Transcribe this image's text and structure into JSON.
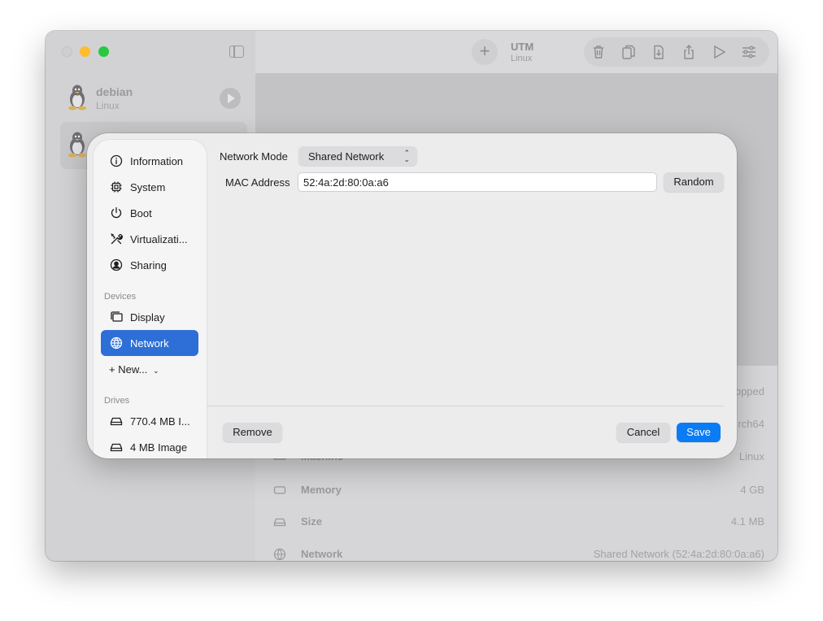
{
  "window": {
    "title": "UTM",
    "subtitle": "Linux",
    "toolbar_icons": [
      "trash-icon",
      "clone-icon",
      "download-icon",
      "share-icon",
      "play-icon",
      "sliders-icon"
    ]
  },
  "vm_list": [
    {
      "name": "debian",
      "os": "Linux"
    },
    {
      "name": "",
      "os": ""
    }
  ],
  "details": {
    "rows": [
      {
        "label": "",
        "value": "opped"
      },
      {
        "label": "",
        "value": "rch64"
      },
      {
        "label": "Machine",
        "value": "Linux"
      },
      {
        "label": "Memory",
        "value": "4 GB"
      },
      {
        "label": "Size",
        "value": "4.1 MB"
      },
      {
        "label": "Network",
        "value": "Shared Network (52:4a:2d:80:0a:a6)"
      }
    ]
  },
  "settings": {
    "nav": [
      {
        "label": "Information",
        "icon": "info-icon"
      },
      {
        "label": "System",
        "icon": "chip-icon"
      },
      {
        "label": "Boot",
        "icon": "power-icon"
      },
      {
        "label": "Virtualizati...",
        "icon": "tools-icon"
      },
      {
        "label": "Sharing",
        "icon": "person-icon"
      }
    ],
    "devices_header": "Devices",
    "devices": [
      {
        "label": "Display",
        "icon": "display-icon"
      },
      {
        "label": "Network",
        "icon": "globe-icon",
        "selected": true
      }
    ],
    "new_label": "+ New...",
    "drives_header": "Drives",
    "drives": [
      {
        "label": "770.4 MB I...",
        "icon": "drive-icon"
      },
      {
        "label": "4 MB Image",
        "icon": "drive-icon"
      }
    ],
    "network_mode_label": "Network Mode",
    "network_mode_value": "Shared Network",
    "mac_label": "MAC Address",
    "mac_value": "52:4a:2d:80:0a:a6",
    "random_label": "Random",
    "remove_label": "Remove",
    "cancel_label": "Cancel",
    "save_label": "Save"
  },
  "colors": {
    "accent": "#0a7cf5",
    "sidebar_selection": "#2d6fd6"
  }
}
